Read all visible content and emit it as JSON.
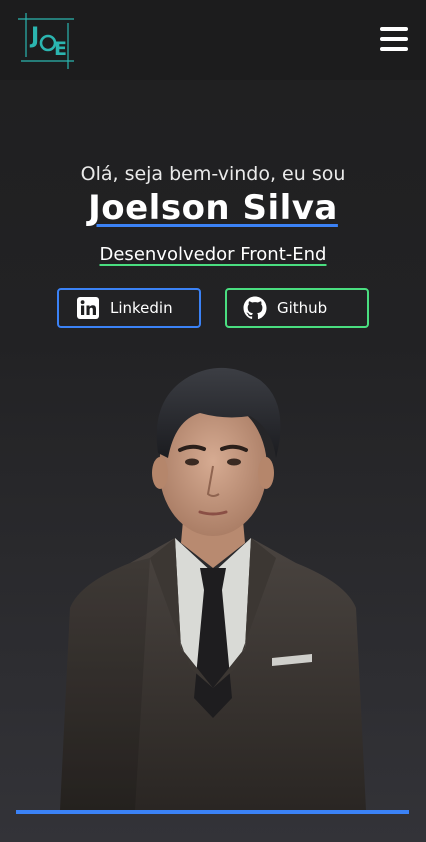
{
  "header": {
    "logo_text": "JOE",
    "menu_icon": "hamburger-menu-icon"
  },
  "hero": {
    "greeting": "Olá, seja bem-vindo, eu sou",
    "name": "Joelson Silva",
    "role": "Desenvolvedor Front-End"
  },
  "social": {
    "linkedin_label": "Linkedin",
    "linkedin_icon": "linkedin-icon",
    "github_label": "Github",
    "github_icon": "github-icon"
  },
  "colors": {
    "accent_blue": "#3b82f6",
    "accent_green": "#4ade80",
    "logo_teal": "#2bb5b0",
    "background": "#222224"
  },
  "portrait": {
    "icon": "portrait-illustration"
  }
}
